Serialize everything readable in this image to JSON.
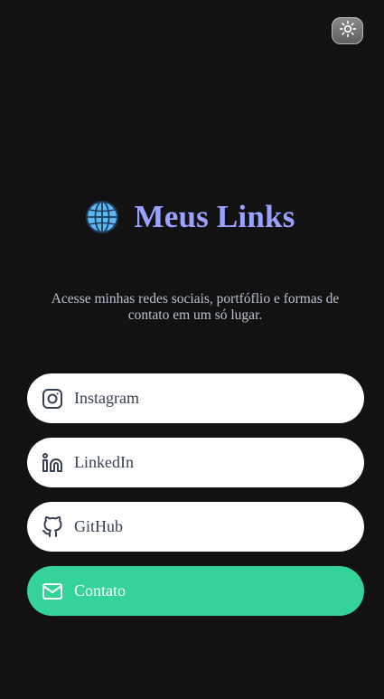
{
  "theme_toggle": {
    "icon": "sun-icon"
  },
  "header": {
    "emoji": "🌐",
    "title": "Meus Links"
  },
  "subtitle": "Acesse minhas redes sociais, portfóflio e formas de contato em um só lugar.",
  "links": [
    {
      "label": "Instagram",
      "icon": "instagram-icon"
    },
    {
      "label": "LinkedIn",
      "icon": "linkedin-icon"
    },
    {
      "label": "GitHub",
      "icon": "github-icon"
    },
    {
      "label": "Contato",
      "icon": "mail-icon"
    }
  ],
  "colors": {
    "background": "#121212",
    "title": "#9aa2ff",
    "subtitle": "#b9c2cf",
    "link_bg": "#ffffff",
    "link_text": "#374151",
    "contact_bg": "#34d399",
    "contact_text": "#ffffff"
  }
}
